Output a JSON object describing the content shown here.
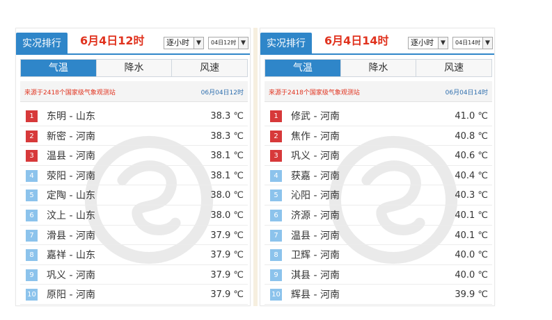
{
  "panels": [
    {
      "rank_tab": "实况排行",
      "time_title": "6月4日12时",
      "hourly_select": "逐小时",
      "time_select": "04日12时",
      "tabs": [
        "气温",
        "降水",
        "风速"
      ],
      "source": "来源于2418个国家级气象观测站",
      "stamp": "06月04日12时",
      "rows": [
        {
          "rank": "1",
          "station": "东明 - 山东",
          "temp": "38.3 ℃"
        },
        {
          "rank": "2",
          "station": "新密 - 河南",
          "temp": "38.3 ℃"
        },
        {
          "rank": "3",
          "station": "温县 - 河南",
          "temp": "38.1 ℃"
        },
        {
          "rank": "4",
          "station": "荥阳 - 河南",
          "temp": "38.1 ℃"
        },
        {
          "rank": "5",
          "station": "定陶 - 山东",
          "temp": "38.0 ℃"
        },
        {
          "rank": "6",
          "station": "汶上 - 山东",
          "temp": "38.0 ℃"
        },
        {
          "rank": "7",
          "station": "滑县 - 河南",
          "temp": "37.9 ℃"
        },
        {
          "rank": "8",
          "station": "嘉祥 - 山东",
          "temp": "37.9 ℃"
        },
        {
          "rank": "9",
          "station": "巩义 - 河南",
          "temp": "37.9 ℃"
        },
        {
          "rank": "10",
          "station": "原阳 - 河南",
          "temp": "37.9 ℃"
        }
      ]
    },
    {
      "rank_tab": "实况排行",
      "time_title": "6月4日14时",
      "hourly_select": "逐小时",
      "time_select": "04日14时",
      "tabs": [
        "气温",
        "降水",
        "风速"
      ],
      "source": "来源于2418个国家级气象观测站",
      "stamp": "06月04日14时",
      "rows": [
        {
          "rank": "1",
          "station": "修武 - 河南",
          "temp": "41.0 ℃"
        },
        {
          "rank": "2",
          "station": "焦作 - 河南",
          "temp": "40.8 ℃"
        },
        {
          "rank": "3",
          "station": "巩义 - 河南",
          "temp": "40.6 ℃"
        },
        {
          "rank": "4",
          "station": "获嘉 - 河南",
          "temp": "40.4 ℃"
        },
        {
          "rank": "5",
          "station": "沁阳 - 河南",
          "temp": "40.3 ℃"
        },
        {
          "rank": "6",
          "station": "济源 - 河南",
          "temp": "40.1 ℃"
        },
        {
          "rank": "7",
          "station": "温县 - 河南",
          "temp": "40.1 ℃"
        },
        {
          "rank": "8",
          "station": "卫辉 - 河南",
          "temp": "40.0 ℃"
        },
        {
          "rank": "9",
          "station": "淇县 - 河南",
          "temp": "40.0 ℃"
        },
        {
          "rank": "10",
          "station": "辉县 - 河南",
          "temp": "39.9 ℃"
        }
      ]
    }
  ],
  "colors": {
    "accent": "#2f86c9",
    "title_red": "#e0321e",
    "rank_top3": "#d7393a",
    "rank_other": "#8cc3ec"
  },
  "icons": {
    "dropdown": "chevron-down-icon",
    "watermark": "swirl-logo-watermark"
  }
}
